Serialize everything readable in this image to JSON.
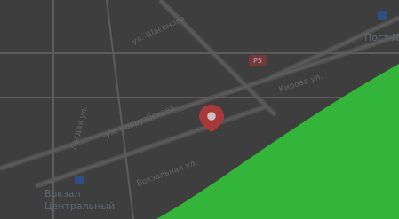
{
  "map": {
    "streets": [
      "ул. Шасенова",
      "ул. Наврузбекова",
      "Вокзальная ул.",
      "Кирова ул.",
      "Лагдая ул."
    ],
    "route_badge": "Р5",
    "station_label_line1": "Вокзал",
    "station_label_line2": "Центральный",
    "post_label": "Пост №",
    "marker": "location-pin"
  },
  "colors": {
    "overlay": "#3a3a3a",
    "road": "#6a6a6a",
    "marker": "#d33b3b",
    "accent_green": "#33b53a"
  }
}
